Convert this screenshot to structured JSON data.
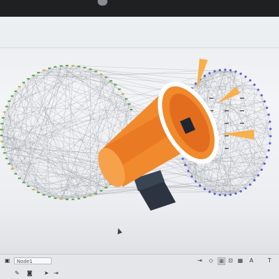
{
  "scene": {
    "subject": "monitor-showing-network-graph-with-megaphone-overlay"
  },
  "toolbar": {
    "field_value": "Node1",
    "icons": [
      "window-icon",
      "brush-icon",
      "camera-icon",
      "pointer-icon",
      "export-icon",
      "diamond-icon",
      "zoom-icon",
      "grid-icon",
      "table-icon",
      "text-icon"
    ]
  },
  "colors": {
    "left_cluster_nodes": "#5aa34c",
    "left_cluster_accent": "#c9b43a",
    "right_cluster_nodes": "#5a5fd0",
    "edges": "#8a8f96",
    "megaphone_body": "#f08a2c",
    "megaphone_shade": "#e36d1e",
    "megaphone_rim": "#ffffff",
    "megaphone_handle": "#2b3440",
    "sound_rays": "#f7b04a"
  }
}
